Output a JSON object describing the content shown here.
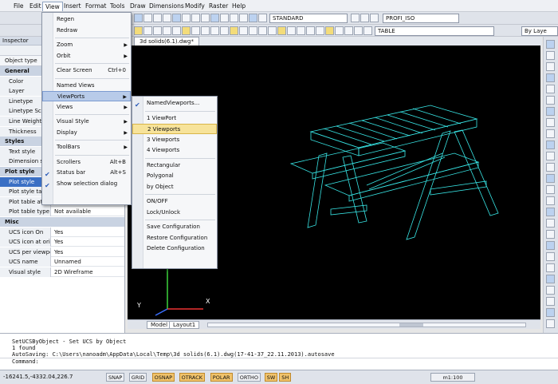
{
  "menubar": {
    "items": [
      "File",
      "Edit",
      "View",
      "Insert",
      "Format",
      "Tools",
      "Draw",
      "Dimensions",
      "Modify",
      "Raster",
      "Help"
    ]
  },
  "toolbar": {
    "text_style": "STANDARD",
    "dim_style": "PROFI_ISO",
    "table_style": "TABLE",
    "layer": "By Laye"
  },
  "document": {
    "tab": "3d solids(6.1).dwg*"
  },
  "inspector": {
    "title": "Inspector",
    "object_type": "Object type",
    "rows": [
      {
        "k": "General",
        "cat": true
      },
      {
        "k": "Color",
        "v": ""
      },
      {
        "k": "Layer",
        "v": ""
      },
      {
        "k": "Linetype",
        "v": ""
      },
      {
        "k": "Linetype Scal",
        "v": ""
      },
      {
        "k": "Line Weight",
        "v": ""
      },
      {
        "k": "Thickness",
        "v": ""
      },
      {
        "k": "Styles",
        "cat": true
      },
      {
        "k": "Text style",
        "v": ""
      },
      {
        "k": "Dimension sty",
        "v": ""
      },
      {
        "k": "Plot style",
        "cat": true
      },
      {
        "k": "Plot style",
        "v": "",
        "sel": true
      },
      {
        "k": "Plot style table",
        "v": ""
      },
      {
        "k": "Plot table attach...",
        "v": "Model"
      },
      {
        "k": "Plot table type",
        "v": "Not available"
      },
      {
        "k": "Misc",
        "cat": true
      },
      {
        "k": "UCS icon On",
        "v": "Yes"
      },
      {
        "k": "UCS icon at origin",
        "v": "Yes"
      },
      {
        "k": "UCS per viewport",
        "v": "Yes"
      },
      {
        "k": "UCS name",
        "v": "Unnamed"
      },
      {
        "k": "Visual style",
        "v": "2D Wireframe"
      }
    ]
  },
  "view_menu": [
    {
      "label": "Regen"
    },
    {
      "label": "Redraw"
    },
    {
      "sep": true
    },
    {
      "label": "Zoom",
      "sub": true
    },
    {
      "label": "Orbit",
      "sub": true
    },
    {
      "sep": true
    },
    {
      "label": "Clear Screen",
      "sc": "Ctrl+0"
    },
    {
      "sep": true
    },
    {
      "label": "Named Views"
    },
    {
      "label": "ViewPorts",
      "sub": true,
      "hl": true
    },
    {
      "label": "Views",
      "sub": true
    },
    {
      "sep": true
    },
    {
      "label": "Visual Style",
      "sub": true
    },
    {
      "label": "Display",
      "sub": true
    },
    {
      "sep": true
    },
    {
      "label": "ToolBars",
      "sub": true
    },
    {
      "sep": true
    },
    {
      "label": "Scrollers",
      "sc": "Alt+B"
    },
    {
      "label": "Status bar",
      "sc": "Alt+S",
      "chk": true
    },
    {
      "label": "Show selection dialog",
      "chk": true
    }
  ],
  "viewports_menu": [
    {
      "label": "NamedViewports...",
      "chk": true
    },
    {
      "sep": true
    },
    {
      "label": "1 ViewPort"
    },
    {
      "label": "2 Viewports",
      "hl": true
    },
    {
      "label": "3 Viewports"
    },
    {
      "label": "4 Viewports"
    },
    {
      "sep": true
    },
    {
      "label": "Rectangular"
    },
    {
      "label": "Polygonal"
    },
    {
      "label": "by Object"
    },
    {
      "sep": true
    },
    {
      "label": "ON/OFF"
    },
    {
      "label": "Lock/Unlock"
    },
    {
      "sep": true
    },
    {
      "label": "Save Configuration"
    },
    {
      "label": "Restore Configuration"
    },
    {
      "label": "Delete Configuration"
    }
  ],
  "layout_tabs": [
    "Model",
    "Layout1"
  ],
  "command_lines": [
    "SetUCSByObject - Set UCS by Object",
    "1 found",
    "AutoSaving: C:\\Users\\nanoadm\\AppData\\Local\\Temp\\3d solids(6.1).dwg(17-41-37_22.11.2013).autosave",
    "Command:"
  ],
  "status": {
    "coords": "-16241.5,-4332.04,226.7",
    "toggles": [
      "SNAP",
      "GRID",
      "OSNAP",
      "OTRACK",
      "POLAR",
      "ORTHO",
      "SW",
      "SH"
    ],
    "on": [
      "OSNAP",
      "OTRACK",
      "POLAR",
      "SW",
      "SH"
    ],
    "scale": "m1:100"
  },
  "ucs": {
    "x": "X",
    "y": "Y"
  },
  "colors": {
    "wire": "#38e6e6",
    "highlight": "#f7e39a"
  }
}
